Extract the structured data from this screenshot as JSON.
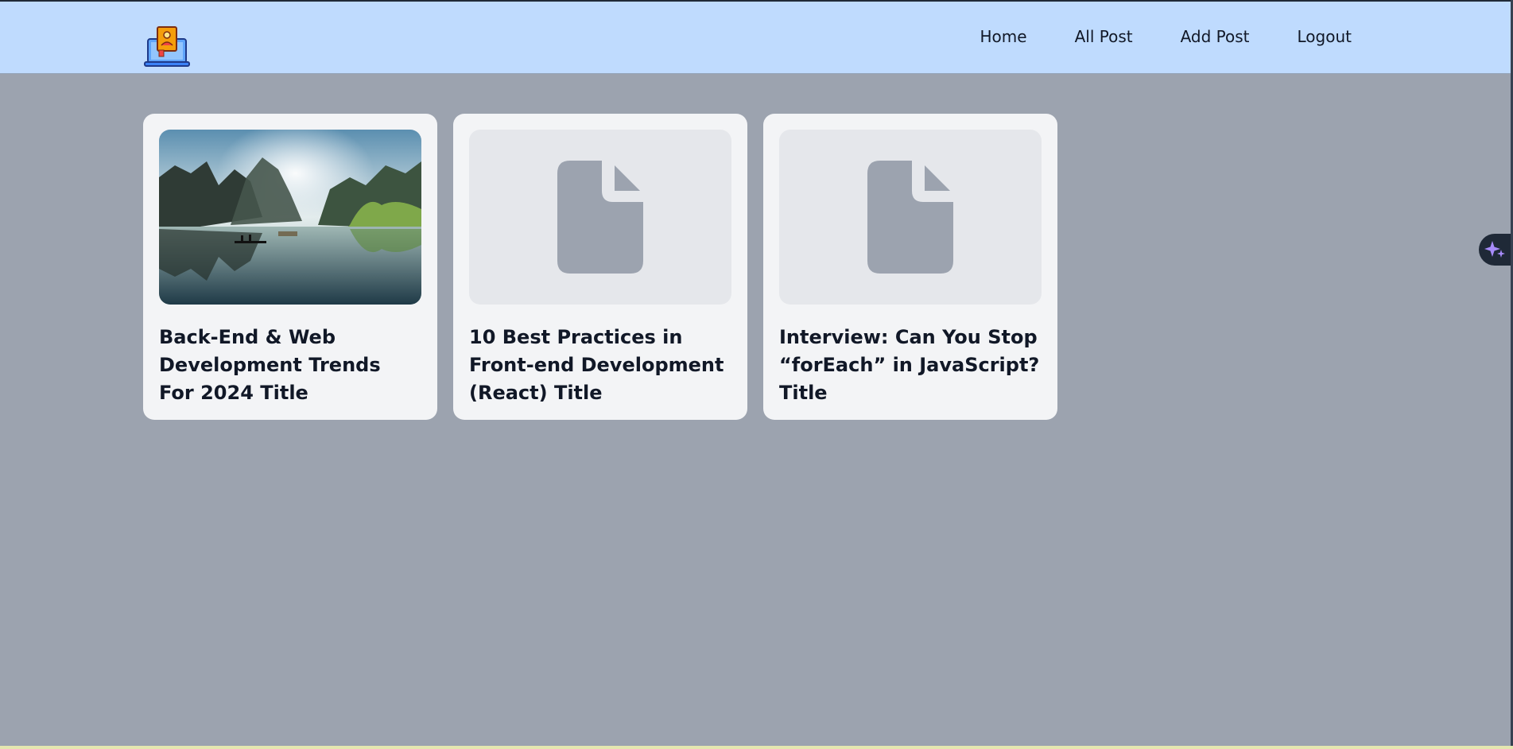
{
  "header": {
    "logo_name": "blog-logo-icon",
    "nav": [
      {
        "label": "Home"
      },
      {
        "label": "All Post"
      },
      {
        "label": "Add Post"
      },
      {
        "label": "Logout"
      }
    ]
  },
  "posts": [
    {
      "title": "Back-End & Web Development Trends For 2024 Title",
      "image": "landscape-photo"
    },
    {
      "title": "10 Best Practices in Front-end Development (React) Title",
      "image": "file-placeholder-icon"
    },
    {
      "title": "Interview: Can You Stop “forEach” in JavaScript? Title",
      "image": "file-placeholder-icon"
    }
  ],
  "colors": {
    "header_bg": "#bfdbfe",
    "page_bg": "#9ca3af",
    "card_bg": "#f3f4f6",
    "placeholder_icon": "#9ca3af",
    "ai_accent": "#a78bfa"
  },
  "floating": {
    "icon": "sparkles-icon"
  }
}
